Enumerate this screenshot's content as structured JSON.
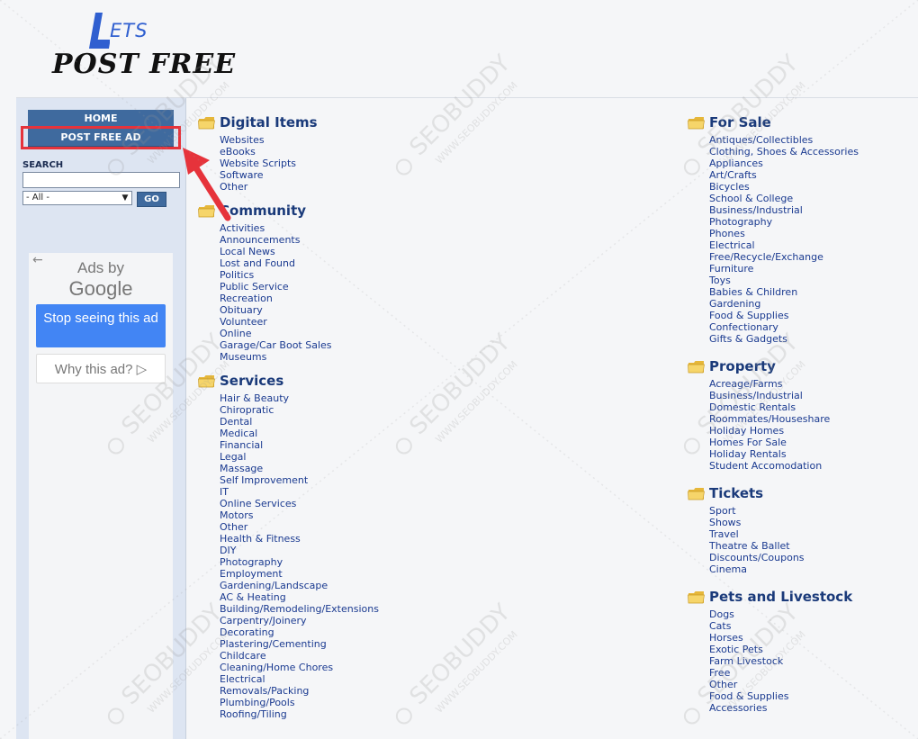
{
  "logo": {
    "top": "ETS",
    "bottom": "POST FREE"
  },
  "sidebar": {
    "home_label": "HOME",
    "post_ad_label": "POST FREE AD",
    "search_label": "SEARCH",
    "search_value": "",
    "category_selected": "- All -",
    "go_label": "GO"
  },
  "ad": {
    "ads_by": "Ads by",
    "google": "Google",
    "stop_label": "Stop seeing this ad",
    "why_label": "Why this ad? ▷"
  },
  "left_sections": [
    {
      "title": "Digital Items",
      "items": [
        "Websites",
        "eBooks",
        "Website Scripts",
        "Software",
        "Other"
      ]
    },
    {
      "title": "Community",
      "items": [
        "Activities",
        "Announcements",
        "Local News",
        "Lost and Found",
        "Politics",
        "Public Service",
        "Recreation",
        "Obituary",
        "Volunteer",
        "Online",
        "Garage/Car Boot Sales",
        "Museums"
      ]
    },
    {
      "title": "Services",
      "items": [
        "Hair & Beauty",
        "Chiropratic",
        "Dental",
        "Medical",
        "Financial",
        "Legal",
        "Massage",
        "Self Improvement",
        "IT",
        "Online Services",
        "Motors",
        "Other",
        "Health & Fitness",
        "DIY",
        "Photography",
        "Employment",
        "Gardening/Landscape",
        "AC & Heating",
        "Building/Remodeling/Extensions",
        "Carpentry/Joinery",
        "Decorating",
        "Plastering/Cementing",
        "Childcare",
        "Cleaning/Home Chores",
        "Electrical",
        "Removals/Packing",
        "Plumbing/Pools",
        "Roofing/Tiling"
      ]
    }
  ],
  "right_sections": [
    {
      "title": "For Sale",
      "items": [
        "Antiques/Collectibles",
        "Clothing, Shoes & Accessories",
        "Appliances",
        "Art/Crafts",
        "Bicycles",
        "School & College",
        "Business/Industrial",
        "Photography",
        "Phones",
        "Electrical",
        "Free/Recycle/Exchange",
        "Furniture",
        "Toys",
        "Babies & Children",
        "Gardening",
        "Food & Supplies",
        "Confectionary",
        "Gifts & Gadgets"
      ]
    },
    {
      "title": "Property",
      "items": [
        "Acreage/Farms",
        "Business/Industrial",
        "Domestic Rentals",
        "Roommates/Houseshare",
        "Holiday Homes",
        "Homes For Sale",
        "Holiday Rentals",
        "Student Accomodation"
      ]
    },
    {
      "title": "Tickets",
      "items": [
        "Sport",
        "Shows",
        "Travel",
        "Theatre & Ballet",
        "Discounts/Coupons",
        "Cinema"
      ]
    },
    {
      "title": "Pets and Livestock",
      "items": [
        "Dogs",
        "Cats",
        "Horses",
        "Exotic Pets",
        "Farm Livestock",
        "Free",
        "Other",
        "Food & Supplies",
        "Accessories"
      ]
    }
  ],
  "watermark": {
    "brand": "SEOBUDDY",
    "url": "WWW.SEOBUDDY.COM"
  },
  "colors": {
    "nav": "#3f6a9e",
    "link": "#1a3a90",
    "highlight": "#e6333b",
    "folder": "#f2c94c"
  }
}
